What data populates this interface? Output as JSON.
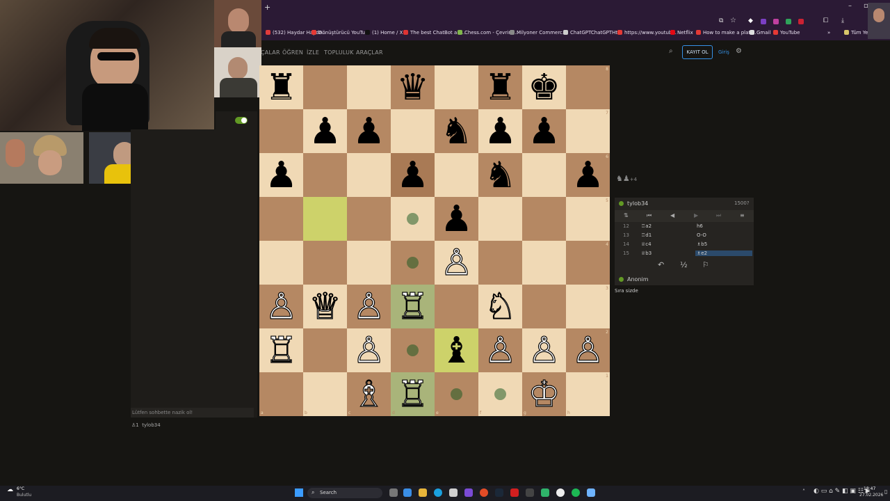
{
  "browser": {
    "new_tab": "+",
    "bookmarks": [
      {
        "label": "(532) Haydar Hayda...",
        "color": "#e23b3b"
      },
      {
        "label": "Dönüştürücü YouTu...",
        "color": "#e53935"
      },
      {
        "label": "(1) Home / X",
        "color": "#111111"
      },
      {
        "label": "The best ChatBot an...",
        "color": "#d33"
      },
      {
        "label": "Chess.com - Çevrim...",
        "color": "#81b64c"
      },
      {
        "label": "Milyoner Commerc...",
        "color": "#888888"
      },
      {
        "label": "ChatGPTChatGPTHt...",
        "color": "#cccccc"
      },
      {
        "label": "https://www.youtub...",
        "color": "#e53935"
      },
      {
        "label": "Netflix",
        "color": "#e50914"
      },
      {
        "label": "How to make a platf...",
        "color": "#e53935"
      },
      {
        "label": "Gmail",
        "color": "#dddddd"
      },
      {
        "label": "YouTube",
        "color": "#e53935"
      },
      {
        "label": "Tüm Yer",
        "color": "#d8c66a"
      }
    ]
  },
  "nav": {
    "items": [
      "ÇALAR",
      "ÖĞREN",
      "İZLE",
      "TOPLULUK",
      "ARAÇLAR"
    ],
    "signup": "KAYIT OL",
    "login": "Giriş"
  },
  "board": {
    "files": [
      "a",
      "b",
      "c",
      "d",
      "e",
      "f",
      "g",
      "h"
    ],
    "ranks": [
      "8",
      "7",
      "6",
      "5",
      "4",
      "3",
      "2",
      "1"
    ],
    "squares": [
      [
        {
          "p": "♜",
          "c": "b"
        },
        {},
        {},
        {
          "p": "♛",
          "c": "b"
        },
        {},
        {
          "p": "♜",
          "c": "b"
        },
        {
          "p": "♚",
          "c": "b"
        },
        {}
      ],
      [
        {},
        {
          "p": "♟",
          "c": "b"
        },
        {
          "p": "♟",
          "c": "b"
        },
        {},
        {
          "p": "♞",
          "c": "b"
        },
        {
          "p": "♟",
          "c": "b"
        },
        {
          "p": "♟",
          "c": "b"
        },
        {}
      ],
      [
        {
          "p": "♟",
          "c": "b"
        },
        {},
        {},
        {
          "p": "♟",
          "c": "b",
          "mark": "check"
        },
        {},
        {
          "p": "♞",
          "c": "b"
        },
        {},
        {
          "p": "♟",
          "c": "b"
        }
      ],
      [
        {},
        {
          "mark": "hl"
        },
        {},
        {
          "mark": "dot"
        },
        {
          "p": "♟",
          "c": "b"
        },
        {},
        {},
        {}
      ],
      [
        {},
        {},
        {},
        {
          "mark": "dot"
        },
        {
          "p": "♙",
          "c": "w"
        },
        {},
        {},
        {}
      ],
      [
        {
          "p": "♙",
          "c": "w"
        },
        {
          "p": "♕",
          "c": "w"
        },
        {
          "p": "♙",
          "c": "w"
        },
        {
          "p": "♖",
          "c": "w",
          "mark": "moved"
        },
        {},
        {
          "p": "♘",
          "c": "w"
        },
        {},
        {}
      ],
      [
        {
          "p": "♖",
          "c": "w"
        },
        {},
        {
          "p": "♙",
          "c": "w"
        },
        {
          "mark": "dot"
        },
        {
          "p": "♝",
          "c": "b",
          "mark": "hl"
        },
        {
          "p": "♙",
          "c": "w"
        },
        {
          "p": "♙",
          "c": "w"
        },
        {
          "p": "♙",
          "c": "w"
        }
      ],
      [
        {},
        {},
        {
          "p": "♗",
          "c": "w"
        },
        {
          "p": "♖",
          "c": "w",
          "mark": "moved"
        },
        {
          "mark": "dot"
        },
        {
          "mark": "dot"
        },
        {
          "p": "♔",
          "c": "w"
        },
        {}
      ]
    ]
  },
  "material": {
    "pieces": "♞♟",
    "diff": "+4"
  },
  "panel": {
    "player_top": "tylob34",
    "rating": "1500?",
    "player_bottom": "Anonim",
    "your_turn": "Sıra sizde",
    "moves": [
      {
        "n": "12",
        "white": "♖a2",
        "black": "h6"
      },
      {
        "n": "13",
        "white": "♖d1",
        "black": "O-O"
      },
      {
        "n": "14",
        "white": "♕c4",
        "black": "♗b5"
      },
      {
        "n": "15",
        "white": "♕b3",
        "black": "♗e2"
      }
    ],
    "draw": "½"
  },
  "chat": {
    "placeholder": "Lütfen sohbette nazik ol!",
    "viewers": "1",
    "viewer_name": "tylob34"
  },
  "taskbar": {
    "weather_temp": "6°C",
    "weather_desc": "Bulutlu",
    "search": "Search",
    "time": "18:47",
    "date": "27.02.2026"
  }
}
